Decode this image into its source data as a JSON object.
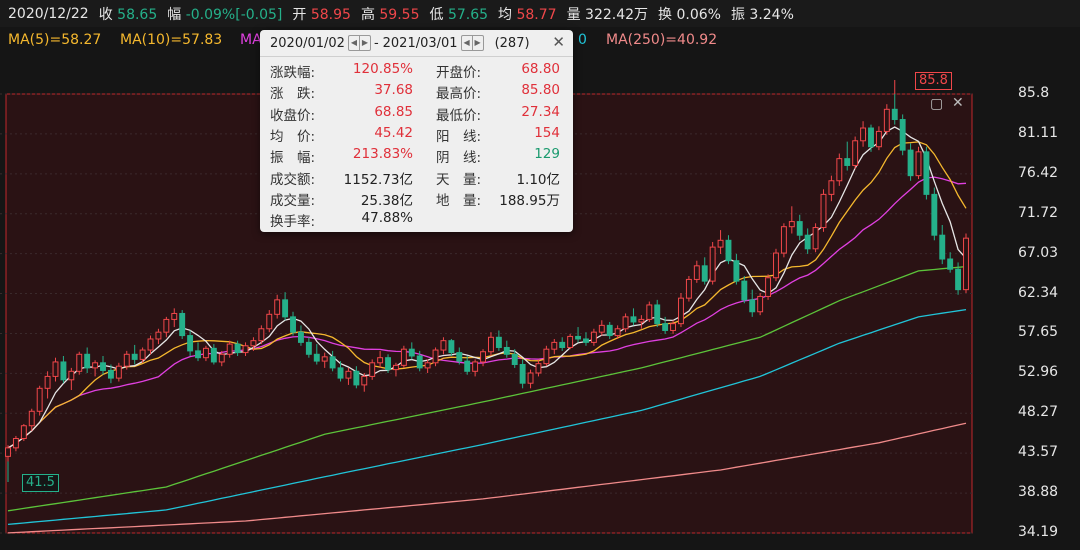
{
  "header": {
    "date": "2020/12/22",
    "close_label": "收",
    "close_value": "58.65",
    "range_label": "幅",
    "range_value": "-0.09%[-0.05]",
    "open_label": "开",
    "open_value": "58.95",
    "high_label": "高",
    "high_value": "59.55",
    "low_label": "低",
    "low_value": "57.65",
    "avg_label": "均",
    "avg_value": "58.77",
    "vol_label": "量",
    "vol_value": "322.42万",
    "turn_label": "换",
    "turn_value": "0.06%",
    "amp_label": "振",
    "amp_value": "3.24%"
  },
  "ma_legend": {
    "ma5": "MA(5)=58.27",
    "ma10": "MA(10)=57.83",
    "ma20_partial": "MA",
    "ma120_partial": "0",
    "ma250": "MA(250)=40.92"
  },
  "popup": {
    "start_date": "2020/01/02",
    "dash": "-",
    "end_date": "2021/03/01",
    "count": "(287)",
    "close_glyph": "✕",
    "rows": [
      {
        "l1": "涨跌幅:",
        "v1": "120.85%",
        "c1": "r",
        "l2": "开盘价:",
        "v2": "68.80",
        "c2": "r"
      },
      {
        "l1": "涨　跌:",
        "v1": "37.68",
        "c1": "r",
        "l2": "最高价:",
        "v2": "85.80",
        "c2": "r"
      },
      {
        "l1": "收盘价:",
        "v1": "68.85",
        "c1": "r",
        "l2": "最低价:",
        "v2": "27.34",
        "c2": "r"
      },
      {
        "l1": "均　价:",
        "v1": "45.42",
        "c1": "r",
        "l2": "阳　线:",
        "v2": "154",
        "c2": "r"
      },
      {
        "l1": "振　幅:",
        "v1": "213.83%",
        "c1": "r",
        "l2": "阴　线:",
        "v2": "129",
        "c2": "g"
      },
      {
        "l1": "成交额:",
        "v1": "1152.73亿",
        "c1": "k",
        "l2": "天　量:",
        "v2": "1.10亿",
        "c2": "k"
      },
      {
        "l1": "成交量:",
        "v1": "25.38亿",
        "c1": "k",
        "l2": "地　量:",
        "v2": "188.95万",
        "c2": "k"
      },
      {
        "l1": "换手率:",
        "v1": "47.88%",
        "c1": "k",
        "l2": "",
        "v2": "",
        "c2": "k"
      }
    ]
  },
  "tags": {
    "high": "85.8",
    "low": "41.5"
  },
  "colors": {
    "up": "#f0474a",
    "down": "#25b08a",
    "ma5": "#e6e6e6",
    "ma10": "#f5b82e",
    "ma20": "#e040e0",
    "ma60": "#5cc33a",
    "ma120": "#21c4d8",
    "ma250": "#f08a8a"
  },
  "chart_data": {
    "type": "candlestick",
    "y_ticks": [
      "85.8",
      "81.11",
      "76.42",
      "71.72",
      "67.03",
      "62.34",
      "57.65",
      "52.96",
      "48.27",
      "43.57",
      "38.88",
      "34.19"
    ],
    "ylim": [
      34.19,
      85.8
    ],
    "candles": [
      [
        43.2,
        44.5,
        42.6,
        44.2
      ],
      [
        44.2,
        45.6,
        43.8,
        45.3
      ],
      [
        45.3,
        47.0,
        45.0,
        46.8
      ],
      [
        46.8,
        48.8,
        46.2,
        48.5
      ],
      [
        48.5,
        51.5,
        48.0,
        51.2
      ],
      [
        51.2,
        53.2,
        50.0,
        52.6
      ],
      [
        52.6,
        54.8,
        52.0,
        54.3
      ],
      [
        54.3,
        55.0,
        51.8,
        52.2
      ],
      [
        52.2,
        53.6,
        51.0,
        53.2
      ],
      [
        53.2,
        55.5,
        52.8,
        55.2
      ],
      [
        55.2,
        56.0,
        53.0,
        53.6
      ],
      [
        53.6,
        54.5,
        52.6,
        54.2
      ],
      [
        54.2,
        55.0,
        52.8,
        53.3
      ],
      [
        53.3,
        54.0,
        51.8,
        52.4
      ],
      [
        52.4,
        54.2,
        52.0,
        53.8
      ],
      [
        53.8,
        55.6,
        53.4,
        55.2
      ],
      [
        55.2,
        56.3,
        54.0,
        54.6
      ],
      [
        54.6,
        56.0,
        54.2,
        55.7
      ],
      [
        55.7,
        57.4,
        55.2,
        57.0
      ],
      [
        57.0,
        58.2,
        56.4,
        57.8
      ],
      [
        57.8,
        59.6,
        57.2,
        59.3
      ],
      [
        59.3,
        60.6,
        58.4,
        60.0
      ],
      [
        60.0,
        60.4,
        57.0,
        57.4
      ],
      [
        57.4,
        58.0,
        55.0,
        55.6
      ],
      [
        55.6,
        56.6,
        54.4,
        54.8
      ],
      [
        54.8,
        56.2,
        54.4,
        55.9
      ],
      [
        55.9,
        56.4,
        54.0,
        54.3
      ],
      [
        54.3,
        55.6,
        53.8,
        55.2
      ],
      [
        55.2,
        56.8,
        54.8,
        56.4
      ],
      [
        56.4,
        56.8,
        55.0,
        55.4
      ],
      [
        55.4,
        56.6,
        55.0,
        56.2
      ],
      [
        56.2,
        57.2,
        55.6,
        56.8
      ],
      [
        56.8,
        58.6,
        56.4,
        58.2
      ],
      [
        58.2,
        60.4,
        57.8,
        59.9
      ],
      [
        59.9,
        62.2,
        59.4,
        61.6
      ],
      [
        61.6,
        62.5,
        59.2,
        59.6
      ],
      [
        59.6,
        60.2,
        57.4,
        57.8
      ],
      [
        57.8,
        58.6,
        56.2,
        56.6
      ],
      [
        56.6,
        57.2,
        54.8,
        55.2
      ],
      [
        55.2,
        56.4,
        54.0,
        54.4
      ],
      [
        54.4,
        55.4,
        53.6,
        54.9
      ],
      [
        54.9,
        55.6,
        53.2,
        53.6
      ],
      [
        53.6,
        54.4,
        52.0,
        52.4
      ],
      [
        52.4,
        53.6,
        51.6,
        53.2
      ],
      [
        53.2,
        53.8,
        51.2,
        51.6
      ],
      [
        51.6,
        53.0,
        50.8,
        52.6
      ],
      [
        52.6,
        54.6,
        52.2,
        54.2
      ],
      [
        54.2,
        55.6,
        53.6,
        54.8
      ],
      [
        54.8,
        55.2,
        53.0,
        53.4
      ],
      [
        53.4,
        54.2,
        52.6,
        53.9
      ],
      [
        53.9,
        56.2,
        53.6,
        55.8
      ],
      [
        55.8,
        56.6,
        54.6,
        55.0
      ],
      [
        55.0,
        55.6,
        53.2,
        53.6
      ],
      [
        53.6,
        54.6,
        53.0,
        54.2
      ],
      [
        54.2,
        56.0,
        53.8,
        55.7
      ],
      [
        55.7,
        57.2,
        55.2,
        56.8
      ],
      [
        56.8,
        57.0,
        55.0,
        55.4
      ],
      [
        55.4,
        56.0,
        54.0,
        54.4
      ],
      [
        54.4,
        55.0,
        52.8,
        53.2
      ],
      [
        53.2,
        54.6,
        52.6,
        54.3
      ],
      [
        54.3,
        55.8,
        53.8,
        55.5
      ],
      [
        55.5,
        57.8,
        55.0,
        57.2
      ],
      [
        57.2,
        58.0,
        55.6,
        56.0
      ],
      [
        56.0,
        56.8,
        54.8,
        55.2
      ],
      [
        55.2,
        55.8,
        53.6,
        54.0
      ],
      [
        54.0,
        54.6,
        51.2,
        51.8
      ],
      [
        51.8,
        53.4,
        51.2,
        53.0
      ],
      [
        53.0,
        54.6,
        52.6,
        54.1
      ],
      [
        54.1,
        56.2,
        53.8,
        55.8
      ],
      [
        55.8,
        57.0,
        55.2,
        56.6
      ],
      [
        56.6,
        57.2,
        55.6,
        56.0
      ],
      [
        56.0,
        57.6,
        55.8,
        57.3
      ],
      [
        57.3,
        58.4,
        56.6,
        57.0
      ],
      [
        57.0,
        57.8,
        56.2,
        56.6
      ],
      [
        56.6,
        58.2,
        56.2,
        57.8
      ],
      [
        57.8,
        59.2,
        57.4,
        58.6
      ],
      [
        58.6,
        59.0,
        57.0,
        57.4
      ],
      [
        57.4,
        58.6,
        57.0,
        58.2
      ],
      [
        58.2,
        60.0,
        57.8,
        59.6
      ],
      [
        59.6,
        60.6,
        58.6,
        59.0
      ],
      [
        59.0,
        59.8,
        58.2,
        59.3
      ],
      [
        59.3,
        61.4,
        59.0,
        61.0
      ],
      [
        61.0,
        61.6,
        58.4,
        58.8
      ],
      [
        58.8,
        59.6,
        57.6,
        58.0
      ],
      [
        58.0,
        59.2,
        57.6,
        58.8
      ],
      [
        58.8,
        62.4,
        58.4,
        61.8
      ],
      [
        61.8,
        64.4,
        61.4,
        64.0
      ],
      [
        64.0,
        66.2,
        63.6,
        65.6
      ],
      [
        65.6,
        66.6,
        63.4,
        63.8
      ],
      [
        63.8,
        68.4,
        63.4,
        67.8
      ],
      [
        67.8,
        69.8,
        67.0,
        68.6
      ],
      [
        68.6,
        69.2,
        65.8,
        66.2
      ],
      [
        66.2,
        67.0,
        63.4,
        63.8
      ],
      [
        63.8,
        64.4,
        61.2,
        61.6
      ],
      [
        61.6,
        62.8,
        59.6,
        60.2
      ],
      [
        60.2,
        62.4,
        59.8,
        62.0
      ],
      [
        62.0,
        64.6,
        61.6,
        64.2
      ],
      [
        64.2,
        67.6,
        63.8,
        67.1
      ],
      [
        67.1,
        70.6,
        66.6,
        70.2
      ],
      [
        70.2,
        72.6,
        69.4,
        70.8
      ],
      [
        70.8,
        71.6,
        68.6,
        69.2
      ],
      [
        69.2,
        70.0,
        67.0,
        67.6
      ],
      [
        67.6,
        70.6,
        67.2,
        70.1
      ],
      [
        70.1,
        74.6,
        69.6,
        74.0
      ],
      [
        74.0,
        76.2,
        73.2,
        75.6
      ],
      [
        75.6,
        78.8,
        75.0,
        78.2
      ],
      [
        78.2,
        80.2,
        76.8,
        77.4
      ],
      [
        77.4,
        80.8,
        77.0,
        80.3
      ],
      [
        80.3,
        82.6,
        79.6,
        81.8
      ],
      [
        81.8,
        82.2,
        79.0,
        79.6
      ],
      [
        79.6,
        82.0,
        79.2,
        81.4
      ],
      [
        81.4,
        84.6,
        81.0,
        84.0
      ],
      [
        84.0,
        85.8,
        82.2,
        82.8
      ],
      [
        82.8,
        83.4,
        78.6,
        79.2
      ],
      [
        79.2,
        80.0,
        75.6,
        76.2
      ],
      [
        76.2,
        79.6,
        75.8,
        79.0
      ],
      [
        79.0,
        79.6,
        73.4,
        74.0
      ],
      [
        74.0,
        74.8,
        68.6,
        69.2
      ],
      [
        69.2,
        70.4,
        65.8,
        66.4
      ],
      [
        66.4,
        67.2,
        64.8,
        65.2
      ],
      [
        65.2,
        66.0,
        62.2,
        62.8
      ],
      [
        62.8,
        69.4,
        62.4,
        68.85
      ]
    ],
    "ma_series": {
      "ma5": "computed",
      "ma10": "computed",
      "ma20": "computed"
    },
    "ma60_points": [
      [
        0,
        36.8
      ],
      [
        20,
        39.6
      ],
      [
        40,
        45.8
      ],
      [
        60,
        49.6
      ],
      [
        80,
        53.6
      ],
      [
        95,
        57.2
      ],
      [
        105,
        61.5
      ],
      [
        115,
        65.0
      ],
      [
        122,
        65.6
      ]
    ],
    "ma120_points": [
      [
        0,
        35.2
      ],
      [
        20,
        36.9
      ],
      [
        40,
        40.8
      ],
      [
        60,
        44.6
      ],
      [
        80,
        48.6
      ],
      [
        95,
        52.6
      ],
      [
        105,
        56.5
      ],
      [
        115,
        59.6
      ],
      [
        122,
        60.6
      ]
    ],
    "ma250_points": [
      [
        0,
        34.2
      ],
      [
        30,
        35.6
      ],
      [
        60,
        38.2
      ],
      [
        90,
        41.6
      ],
      [
        110,
        44.8
      ],
      [
        122,
        47.3
      ]
    ]
  }
}
